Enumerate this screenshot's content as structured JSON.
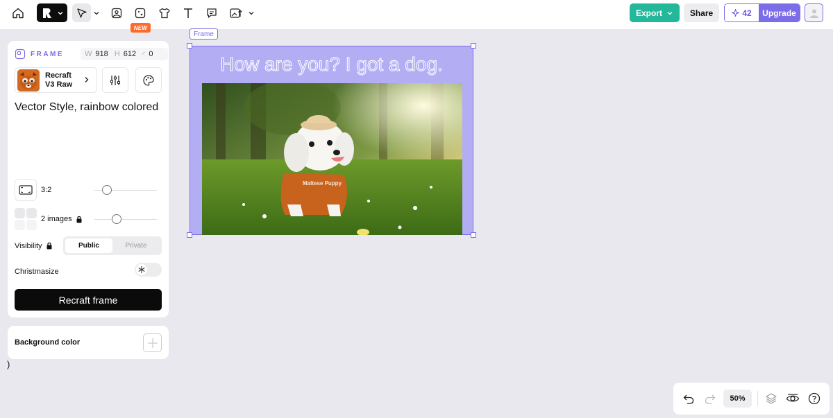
{
  "toolbar": {
    "icons": [
      "home-icon",
      "recraft-logo",
      "select-arrow-icon",
      "image-icon",
      "sticker-icon",
      "tshirt-icon",
      "text-icon",
      "comment-icon",
      "upload-image-icon"
    ],
    "new_badge": "NEW",
    "export_label": "Export",
    "share_label": "Share",
    "credits": "42",
    "upgrade_label": "Upgrade"
  },
  "panel": {
    "frame_label": "FRAME",
    "width_key": "W",
    "width_val": "918",
    "height_key": "H",
    "height_val": "612",
    "radius_key": "◜",
    "radius_val": "0",
    "model_line1": "Recraft",
    "model_line2": "V3 Raw",
    "prompt": "Vector Style, rainbow colored",
    "ratio_label": "3:2",
    "ratio_level": 0.2,
    "images_label": "2 images",
    "images_level": 0.35,
    "visibility_label": "Visibility",
    "visibility_options": [
      "Public",
      "Private"
    ],
    "visibility_selected": "Public",
    "christmasize_label": "Christmasize",
    "christmasize_on": false,
    "recraft_button": "Recraft frame"
  },
  "background_panel": {
    "label": "Background color"
  },
  "stray_text": ")",
  "canvas": {
    "frame_tag": "Frame",
    "frame_title": "How are you? I got a dog.",
    "frame_color": "#b3adf4",
    "photo_text": "Maltese Puppy"
  },
  "bottom_bar": {
    "zoom": "50%"
  },
  "colors": {
    "accent": "#7b6ce8",
    "export": "#23b89a",
    "new_badge": "#ff6a2b"
  }
}
